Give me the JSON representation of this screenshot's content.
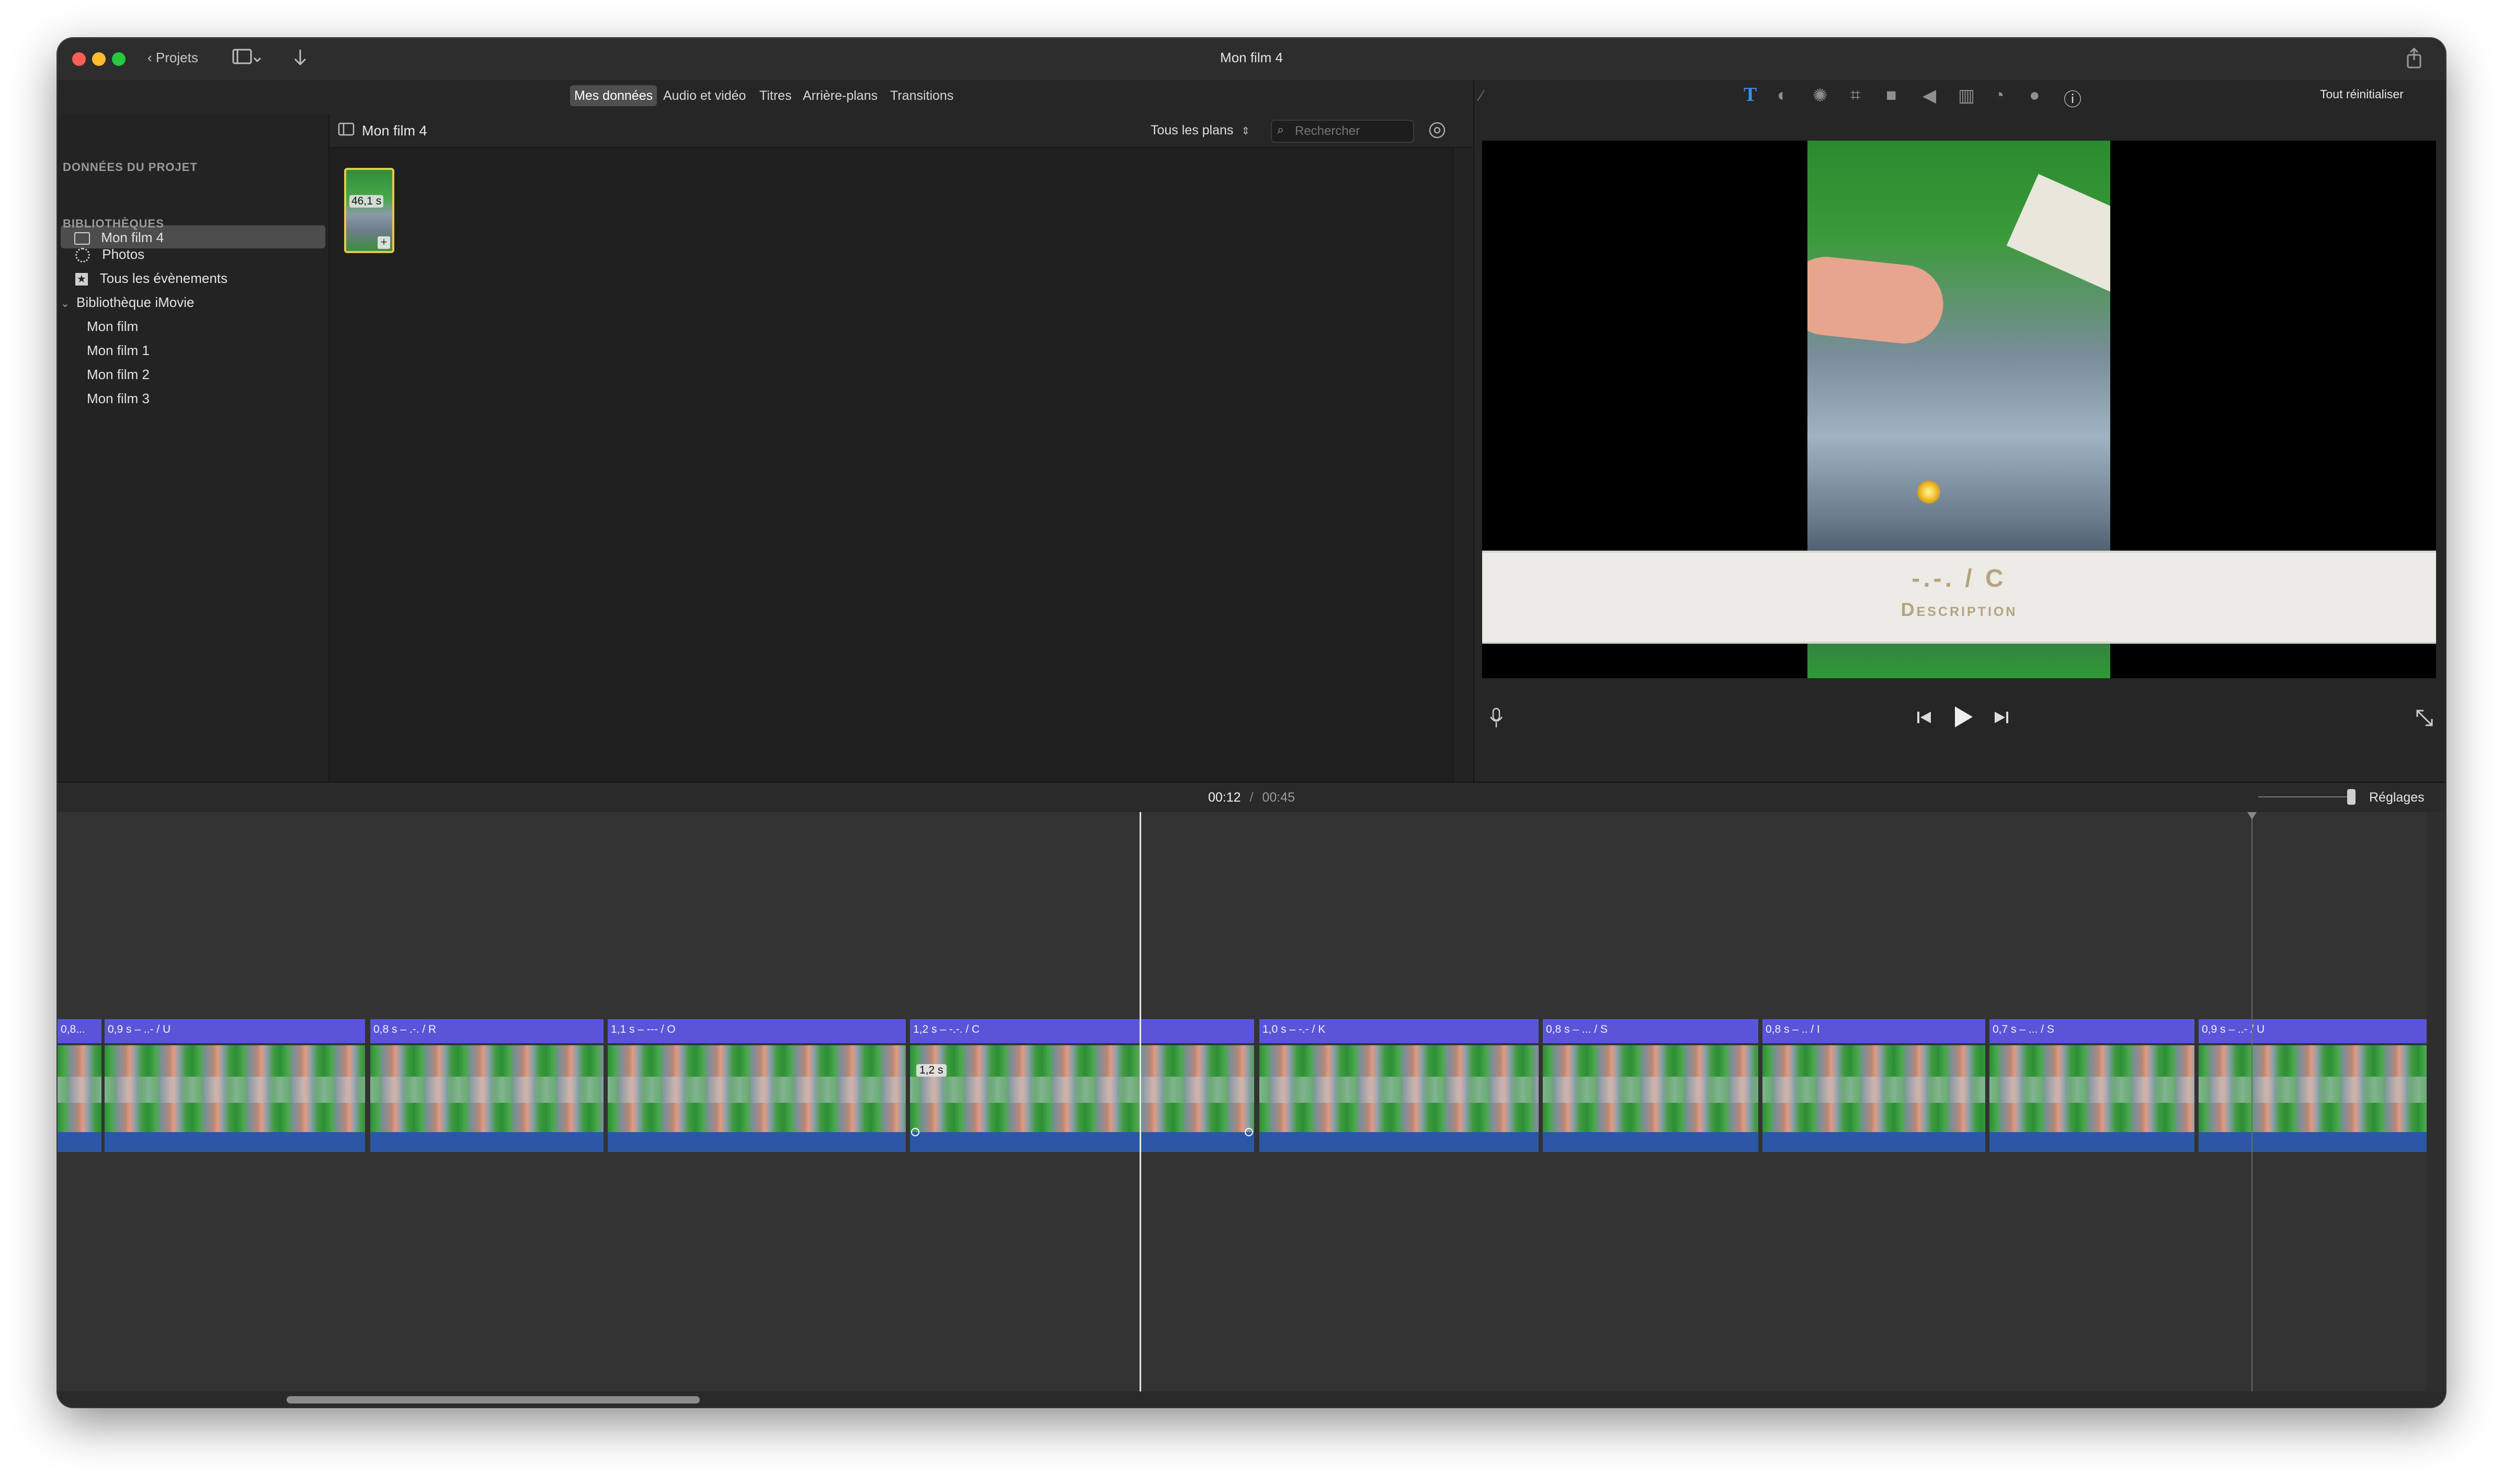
{
  "window": {
    "title": "Mon film 4",
    "back_label": "Projets",
    "traffic_colors": [
      "#ff5f57",
      "#febc2e",
      "#28c840"
    ]
  },
  "tabs": [
    {
      "label": "Mes données",
      "active": true
    },
    {
      "label": "Audio et vidéo",
      "active": false
    },
    {
      "label": "Titres",
      "active": false
    },
    {
      "label": "Arrière-plans",
      "active": false
    },
    {
      "label": "Transitions",
      "active": false
    }
  ],
  "inspector": {
    "reset_label": "Tout réinitialiser",
    "icons": [
      "magic-wand-icon",
      "title-icon",
      "color-balance-icon",
      "color-correction-icon",
      "crop-icon",
      "stabilization-icon",
      "volume-icon",
      "equalizer-icon",
      "speed-icon",
      "noise-reduction-icon",
      "info-icon"
    ]
  },
  "sidebar": {
    "project_header": "DONNÉES DU PROJET",
    "project_item": "Mon film 4",
    "libraries_header": "BIBLIOTHÈQUES",
    "photos": "Photos",
    "all_events": "Tous les évènements",
    "imovie_library": "Bibliothèque iMovie",
    "library_items": [
      "Mon film",
      "Mon film 1",
      "Mon film 2",
      "Mon film 3"
    ]
  },
  "browser": {
    "title": "Mon film 4",
    "filter": "Tous les plans",
    "search_placeholder": "Rechercher",
    "clip_duration": "46,1 s"
  },
  "viewer": {
    "title_line": "-.-. / C",
    "subtitle_line": "Description"
  },
  "timeline": {
    "current_time": "00:12",
    "separator": "/",
    "total_time": "00:45",
    "settings_label": "Réglages",
    "selected_clip_badge": "1,2 s",
    "clips": [
      {
        "label": "0,8..."
      },
      {
        "label": "0,9 s – ..- / U"
      },
      {
        "label": "0,8 s – .-. / R"
      },
      {
        "label": "1,1 s – --- / O"
      },
      {
        "label": "1,2 s – -.-. / C"
      },
      {
        "label": "1,0 s – -.- / K"
      },
      {
        "label": "0,8 s – ... / S"
      },
      {
        "label": "0,8 s – .. / I"
      },
      {
        "label": "0,7 s – ... / S"
      },
      {
        "label": "0,9 s – ..- / U"
      }
    ]
  }
}
